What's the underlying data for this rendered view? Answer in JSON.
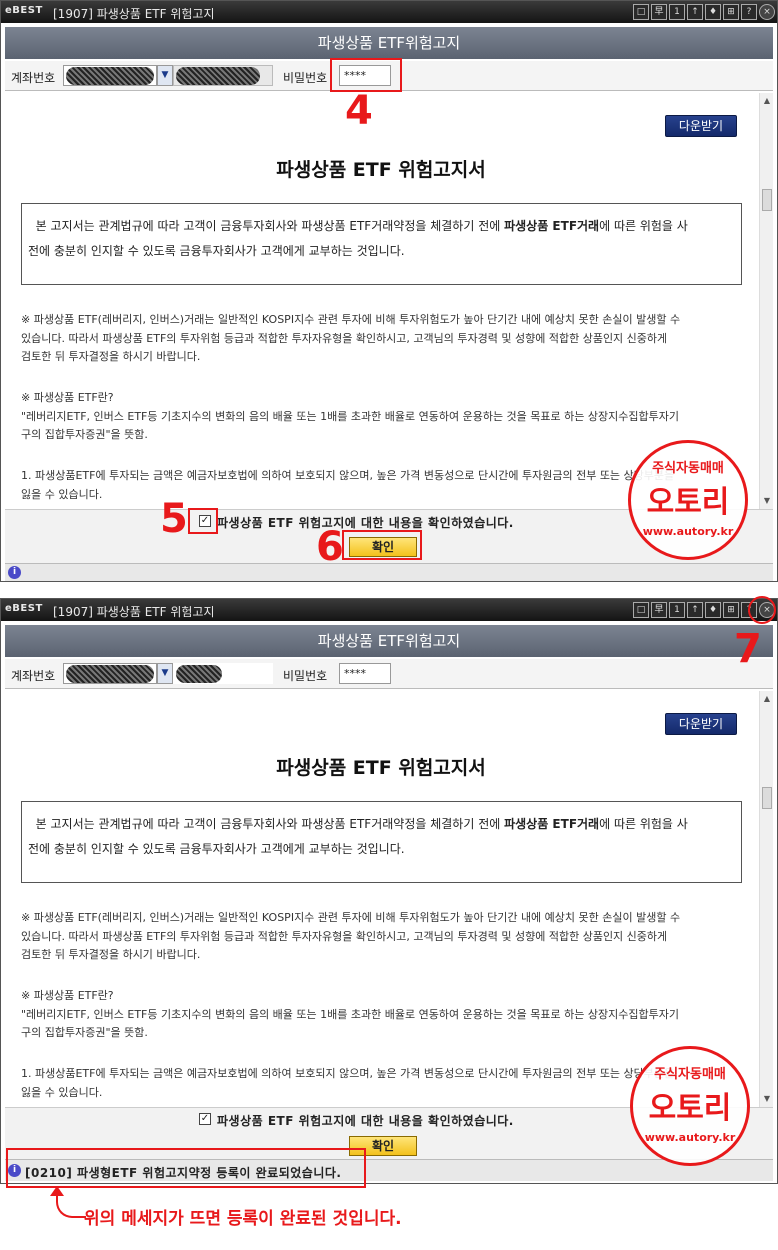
{
  "window": {
    "logo": "eBEST",
    "title": "[1907] 파생상품 ETF 위험고지",
    "controls": [
      "□",
      "早",
      "1",
      "↑",
      "♦",
      "⊞",
      "?"
    ]
  },
  "banner_title": "파생상품 ETF위험고지",
  "account": {
    "account_label": "계좌번호",
    "password_label": "비밀번호",
    "password_value": "****"
  },
  "document": {
    "download_label": "다운받기",
    "title": "파생상품 ETF 위험고지서",
    "notice_line1_pre": "본 고지서는 관계법규에 따라 고객이 금융투자회사와 파생상품 ETF거래약정을 체결하기 전에 ",
    "notice_line1_bold": "파생상품 ETF거래",
    "notice_line1_post": "에 따른 위험을 사",
    "notice_line2": "전에 충분히 인지할 수 있도록 금융투자회사가 고객에게 교부하는 것입니다.",
    "para1_l1": "※ 파생상품 ETF(레버리지, 인버스)거래는 일반적인 KOSPI지수 관련 투자에 비해 투자위험도가 높아 단기간 내에 예상치 못한 손실이 발생할 수",
    "para1_l2": "있습니다. 따라서 파생상품 ETF의 투자위험 등급과 적합한 투자자유형을 확인하시고, 고객님의 투자경력 및 성향에 적합한 상품인지 신중하게",
    "para1_l3": "검토한 뒤 투자결정을 하시기 바랍니다.",
    "para2_l1": "※ 파생상품 ETF란?",
    "para2_l2": "\"레버리지ETF, 인버스 ETF등 기초지수의 변화의 음의 배율 또는 1배를 초과한 배율로 연동하여 운용하는 것을 목표로 하는 상장지수집합투자기",
    "para2_l3": "구의 집합투자증권\"을 뜻함.",
    "para3_l1": "1. 파생상품ETF에 투자되는 금액은 예금자보호법에 의하여 보호되지 않으며, 높은 가격 변동성으로 단시간에 투자원금의 전부 또는 상당부분을",
    "para3_l2": "잃을 수 있습니다."
  },
  "agree": {
    "checkmark": "✓",
    "label": "파생상품 ETF 위험고지에 대한 내용을 확인하였습니다.",
    "confirm_label": "확인"
  },
  "status_message": "[0210] 파생형ETF 위험고지약정 등록이 완료되었습니다.",
  "annotations": {
    "step4": "4",
    "step5": "5",
    "step6": "6",
    "step7": "7",
    "caption": "위의 메세지가 뜨면 등록이 완료된 것입니다."
  },
  "watermark": {
    "line1": "주식자동매매",
    "line2": "오토리",
    "line3": "www.autory.kr"
  },
  "colors": {
    "titlebar": "#1e1e1e",
    "banner": "#6b7280",
    "download_button": "#1f3a85",
    "confirm_button": "#f5c518",
    "annotation_red": "#e8191b"
  }
}
